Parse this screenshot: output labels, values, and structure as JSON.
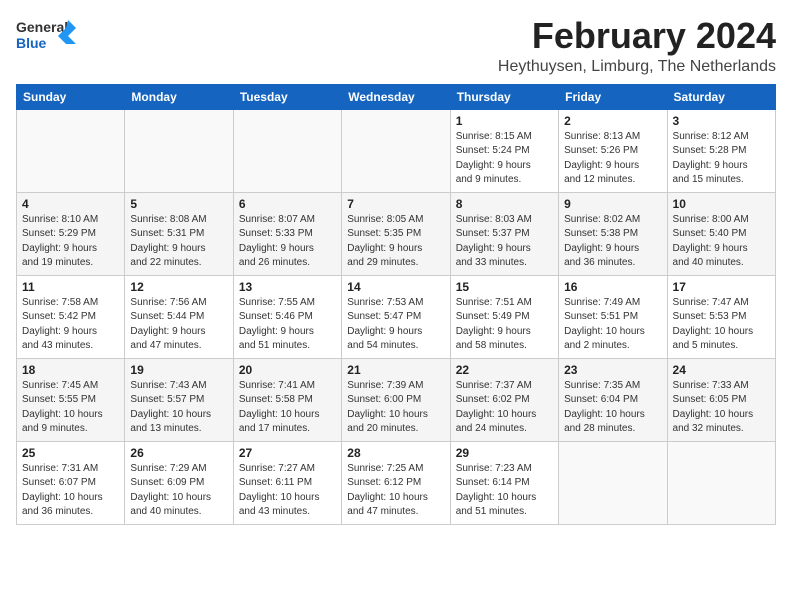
{
  "header": {
    "logo_general": "General",
    "logo_blue": "Blue",
    "month_year": "February 2024",
    "location": "Heythuysen, Limburg, The Netherlands"
  },
  "days_of_week": [
    "Sunday",
    "Monday",
    "Tuesday",
    "Wednesday",
    "Thursday",
    "Friday",
    "Saturday"
  ],
  "weeks": [
    [
      {
        "day": "",
        "info": ""
      },
      {
        "day": "",
        "info": ""
      },
      {
        "day": "",
        "info": ""
      },
      {
        "day": "",
        "info": ""
      },
      {
        "day": "1",
        "info": "Sunrise: 8:15 AM\nSunset: 5:24 PM\nDaylight: 9 hours\nand 9 minutes."
      },
      {
        "day": "2",
        "info": "Sunrise: 8:13 AM\nSunset: 5:26 PM\nDaylight: 9 hours\nand 12 minutes."
      },
      {
        "day": "3",
        "info": "Sunrise: 8:12 AM\nSunset: 5:28 PM\nDaylight: 9 hours\nand 15 minutes."
      }
    ],
    [
      {
        "day": "4",
        "info": "Sunrise: 8:10 AM\nSunset: 5:29 PM\nDaylight: 9 hours\nand 19 minutes."
      },
      {
        "day": "5",
        "info": "Sunrise: 8:08 AM\nSunset: 5:31 PM\nDaylight: 9 hours\nand 22 minutes."
      },
      {
        "day": "6",
        "info": "Sunrise: 8:07 AM\nSunset: 5:33 PM\nDaylight: 9 hours\nand 26 minutes."
      },
      {
        "day": "7",
        "info": "Sunrise: 8:05 AM\nSunset: 5:35 PM\nDaylight: 9 hours\nand 29 minutes."
      },
      {
        "day": "8",
        "info": "Sunrise: 8:03 AM\nSunset: 5:37 PM\nDaylight: 9 hours\nand 33 minutes."
      },
      {
        "day": "9",
        "info": "Sunrise: 8:02 AM\nSunset: 5:38 PM\nDaylight: 9 hours\nand 36 minutes."
      },
      {
        "day": "10",
        "info": "Sunrise: 8:00 AM\nSunset: 5:40 PM\nDaylight: 9 hours\nand 40 minutes."
      }
    ],
    [
      {
        "day": "11",
        "info": "Sunrise: 7:58 AM\nSunset: 5:42 PM\nDaylight: 9 hours\nand 43 minutes."
      },
      {
        "day": "12",
        "info": "Sunrise: 7:56 AM\nSunset: 5:44 PM\nDaylight: 9 hours\nand 47 minutes."
      },
      {
        "day": "13",
        "info": "Sunrise: 7:55 AM\nSunset: 5:46 PM\nDaylight: 9 hours\nand 51 minutes."
      },
      {
        "day": "14",
        "info": "Sunrise: 7:53 AM\nSunset: 5:47 PM\nDaylight: 9 hours\nand 54 minutes."
      },
      {
        "day": "15",
        "info": "Sunrise: 7:51 AM\nSunset: 5:49 PM\nDaylight: 9 hours\nand 58 minutes."
      },
      {
        "day": "16",
        "info": "Sunrise: 7:49 AM\nSunset: 5:51 PM\nDaylight: 10 hours\nand 2 minutes."
      },
      {
        "day": "17",
        "info": "Sunrise: 7:47 AM\nSunset: 5:53 PM\nDaylight: 10 hours\nand 5 minutes."
      }
    ],
    [
      {
        "day": "18",
        "info": "Sunrise: 7:45 AM\nSunset: 5:55 PM\nDaylight: 10 hours\nand 9 minutes."
      },
      {
        "day": "19",
        "info": "Sunrise: 7:43 AM\nSunset: 5:57 PM\nDaylight: 10 hours\nand 13 minutes."
      },
      {
        "day": "20",
        "info": "Sunrise: 7:41 AM\nSunset: 5:58 PM\nDaylight: 10 hours\nand 17 minutes."
      },
      {
        "day": "21",
        "info": "Sunrise: 7:39 AM\nSunset: 6:00 PM\nDaylight: 10 hours\nand 20 minutes."
      },
      {
        "day": "22",
        "info": "Sunrise: 7:37 AM\nSunset: 6:02 PM\nDaylight: 10 hours\nand 24 minutes."
      },
      {
        "day": "23",
        "info": "Sunrise: 7:35 AM\nSunset: 6:04 PM\nDaylight: 10 hours\nand 28 minutes."
      },
      {
        "day": "24",
        "info": "Sunrise: 7:33 AM\nSunset: 6:05 PM\nDaylight: 10 hours\nand 32 minutes."
      }
    ],
    [
      {
        "day": "25",
        "info": "Sunrise: 7:31 AM\nSunset: 6:07 PM\nDaylight: 10 hours\nand 36 minutes."
      },
      {
        "day": "26",
        "info": "Sunrise: 7:29 AM\nSunset: 6:09 PM\nDaylight: 10 hours\nand 40 minutes."
      },
      {
        "day": "27",
        "info": "Sunrise: 7:27 AM\nSunset: 6:11 PM\nDaylight: 10 hours\nand 43 minutes."
      },
      {
        "day": "28",
        "info": "Sunrise: 7:25 AM\nSunset: 6:12 PM\nDaylight: 10 hours\nand 47 minutes."
      },
      {
        "day": "29",
        "info": "Sunrise: 7:23 AM\nSunset: 6:14 PM\nDaylight: 10 hours\nand 51 minutes."
      },
      {
        "day": "",
        "info": ""
      },
      {
        "day": "",
        "info": ""
      }
    ]
  ]
}
